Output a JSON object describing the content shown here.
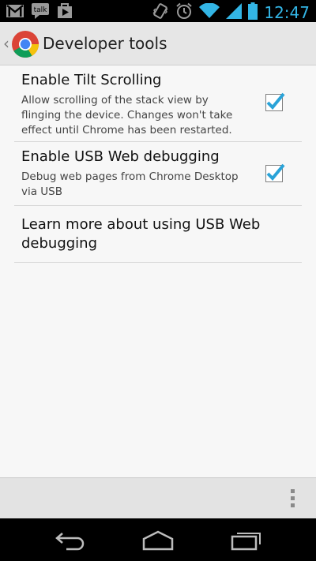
{
  "status_bar": {
    "time": "12:47",
    "left_icons": [
      "gmail-icon",
      "talk-icon",
      "play-store-icon"
    ],
    "talk_label": "talk",
    "right_icons": [
      "vibrate-icon",
      "alarm-icon",
      "wifi-icon",
      "signal-icon",
      "battery-icon"
    ]
  },
  "action_bar": {
    "title": "Developer tools",
    "icon": "chrome-icon"
  },
  "preferences": [
    {
      "title": "Enable Tilt Scrolling",
      "summary": "Allow scrolling of the stack view by flinging the device. Changes won't take effect until Chrome has been restarted.",
      "checked": true
    },
    {
      "title": "Enable USB Web debugging",
      "summary": "Debug web pages from Chrome Desktop via USB",
      "checked": true
    }
  ],
  "link_item": {
    "title": "Learn more about using USB Web debugging"
  },
  "bottom_bar": {
    "icon": "overflow-menu-icon"
  },
  "nav_bar": {
    "buttons": [
      "back-icon",
      "home-icon",
      "recents-icon"
    ]
  },
  "colors": {
    "holo_blue": "#33b5e5",
    "checkmark": "#2aa3d8"
  }
}
